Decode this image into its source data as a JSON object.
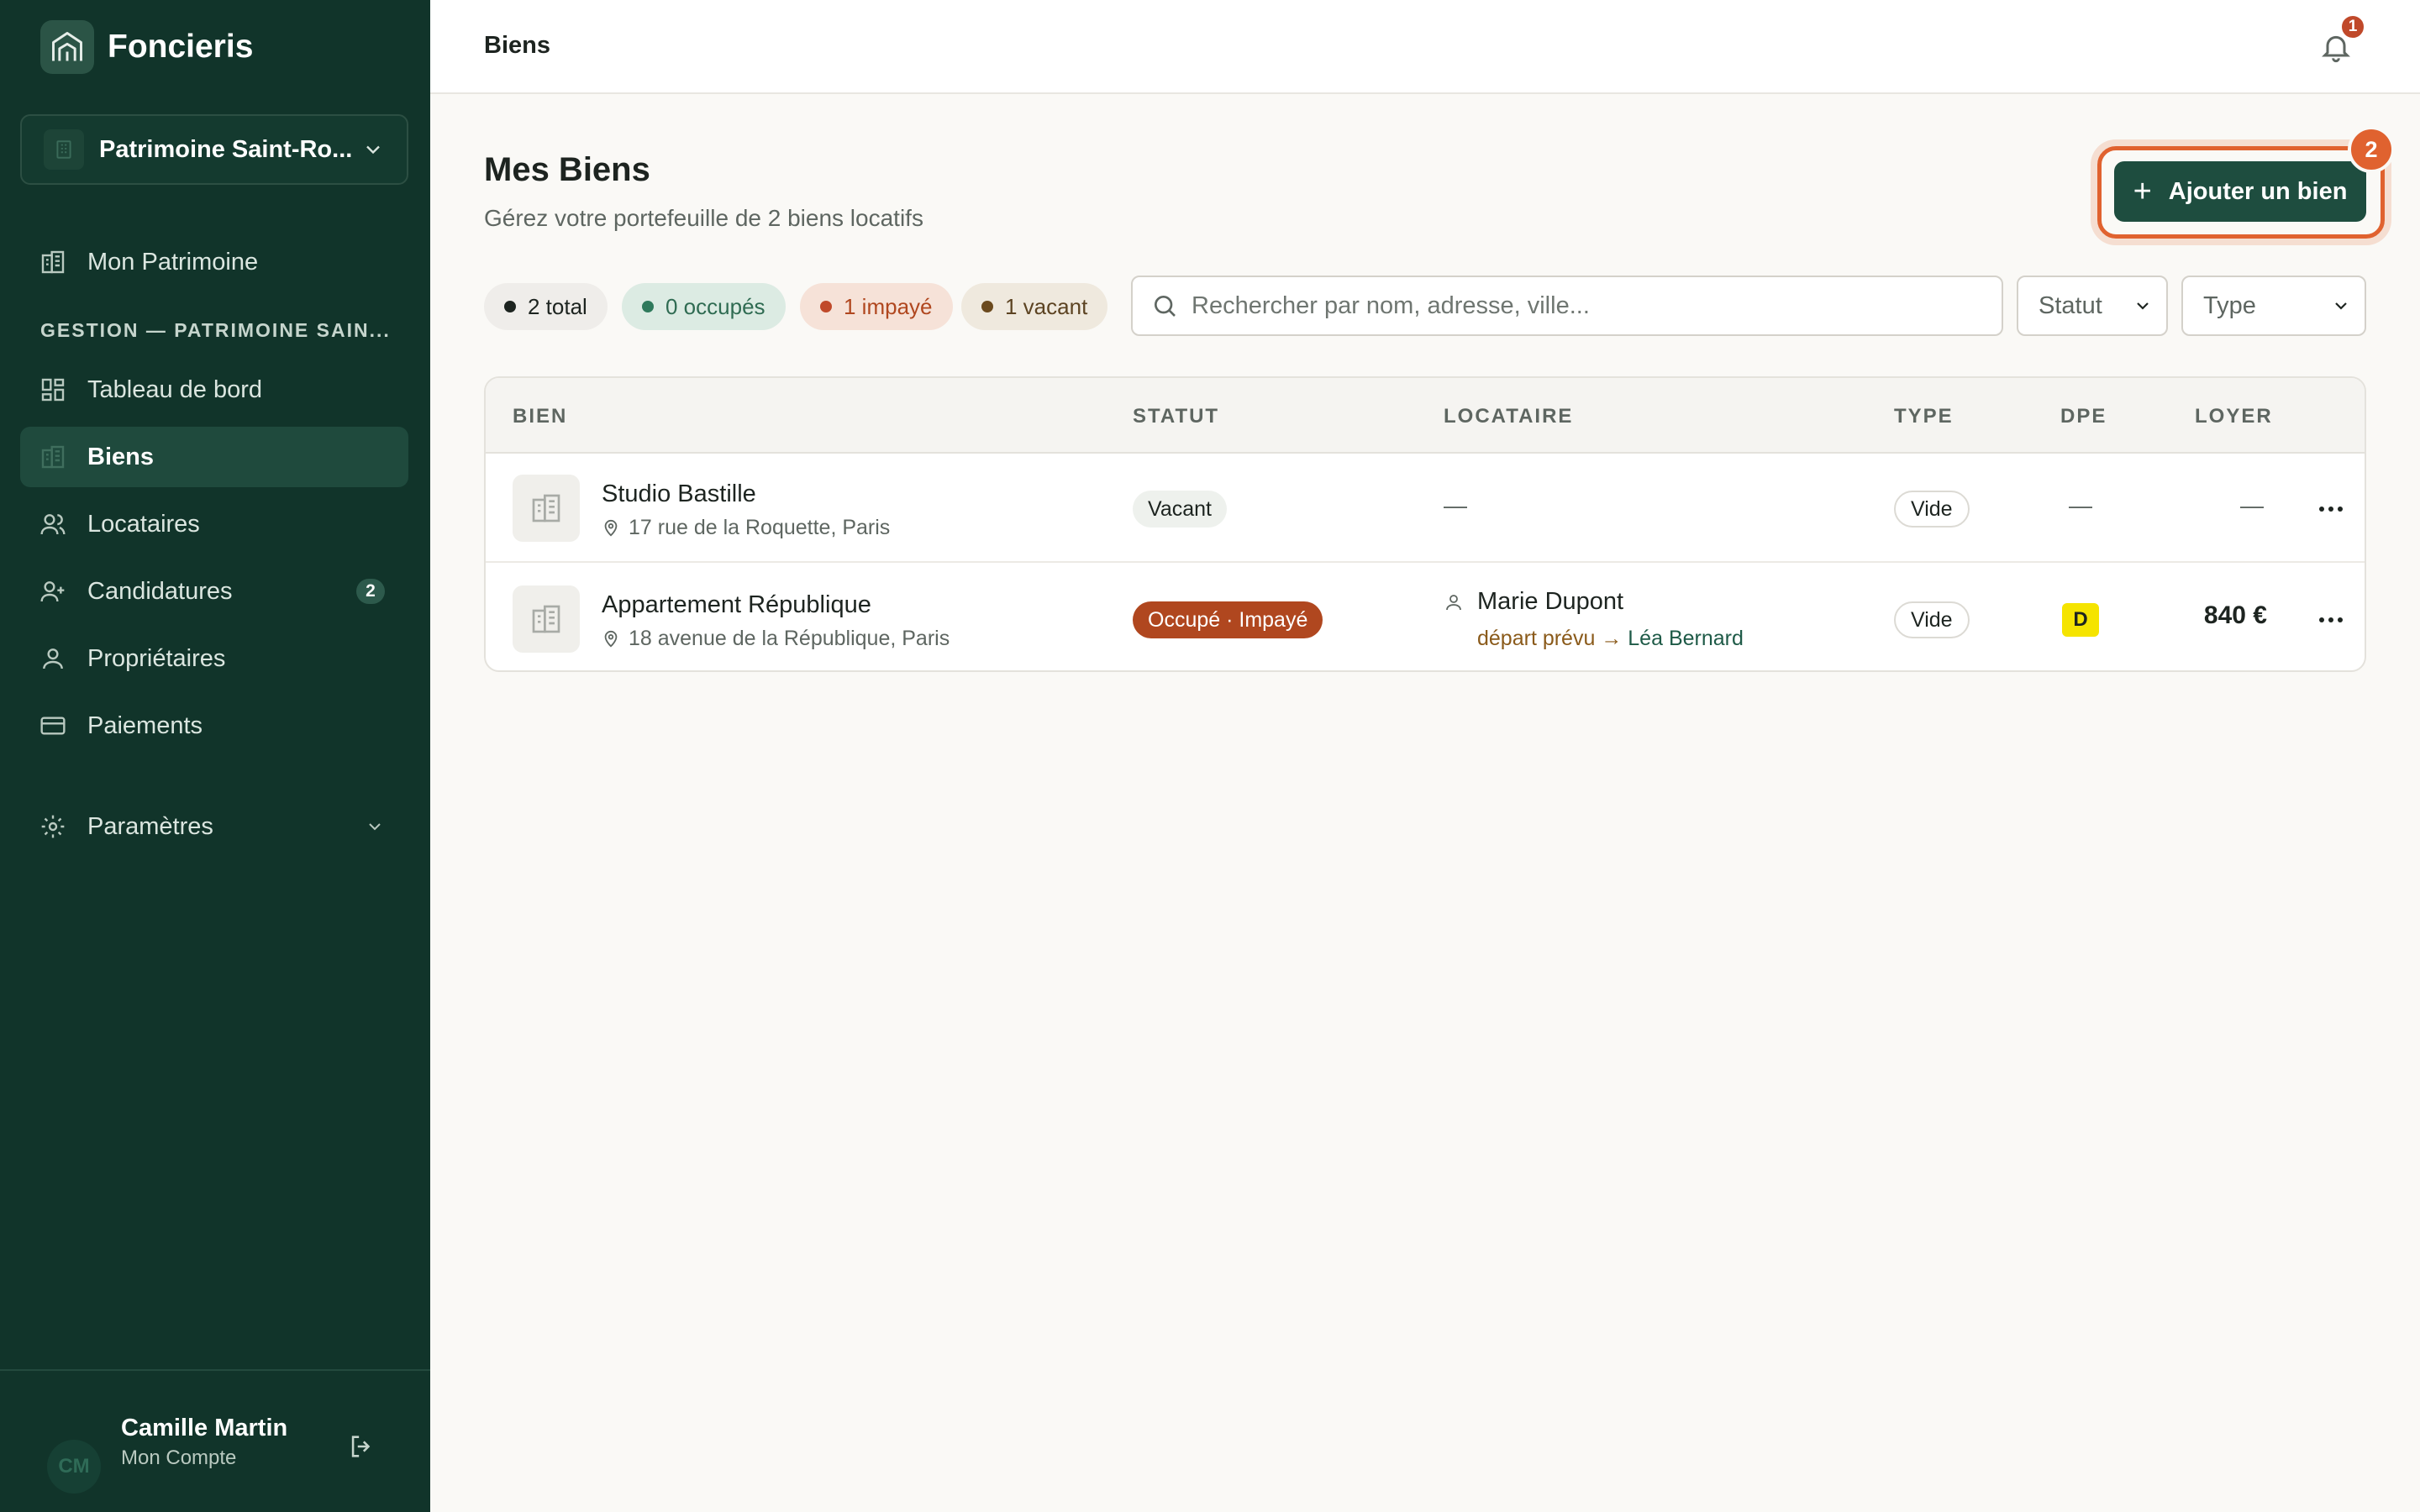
{
  "app": {
    "name": "Foncieris"
  },
  "org_switcher": {
    "label": "Patrimoine Saint-Ro..."
  },
  "nav": {
    "top_item": {
      "label": "Mon Patrimoine"
    },
    "section_label": "GESTION — PATRIMOINE SAIN...",
    "items": [
      {
        "label": "Tableau de bord",
        "icon": "dashboard-icon"
      },
      {
        "label": "Biens",
        "icon": "building-icon",
        "active": true
      },
      {
        "label": "Locataires",
        "icon": "users-icon"
      },
      {
        "label": "Candidatures",
        "icon": "user-plus-icon",
        "count": "2"
      },
      {
        "label": "Propriétaires",
        "icon": "user-icon"
      },
      {
        "label": "Paiements",
        "icon": "card-icon"
      }
    ],
    "settings": {
      "label": "Paramètres",
      "icon": "gear-icon"
    }
  },
  "user": {
    "initials": "CM",
    "name": "Camille Martin",
    "subtitle": "Mon Compte"
  },
  "header": {
    "breadcrumb": "Biens",
    "notifications": "1"
  },
  "main": {
    "title": "Mes Biens",
    "subtitle": "Gérez votre portefeuille de 2 biens locatifs",
    "add_button": "Ajouter un bien",
    "step_badge": "2",
    "chips": [
      {
        "label": "2 total",
        "bg": "#efedea",
        "dot": "#1d2420",
        "color": "#1d2420"
      },
      {
        "label": "0 occupés",
        "bg": "#dcebe3",
        "dot": "#2f7a5c",
        "color": "#2f6b52"
      },
      {
        "label": "1 impayé",
        "bg": "#f6e2d8",
        "dot": "#c0492a",
        "color": "#b0471f"
      },
      {
        "label": "1 vacant",
        "bg": "#efe9de",
        "dot": "#6b4a1e",
        "color": "#5c4322"
      }
    ],
    "search": {
      "placeholder": "Rechercher par nom, adresse, ville..."
    },
    "filters": {
      "status": "Statut",
      "type": "Type"
    }
  },
  "table": {
    "headers": [
      "BIEN",
      "STATUT",
      "LOCATAIRE",
      "TYPE",
      "DPE",
      "LOYER"
    ],
    "rows": [
      {
        "name": "Studio Bastille",
        "address": "17 rue de la Roquette, Paris",
        "status": "Vacant",
        "tenant": "—",
        "type": "Vide",
        "dpe": "—",
        "rent": "—"
      },
      {
        "name": "Appartement République",
        "address": "18 avenue de la République, Paris",
        "status": "Occupé · Impayé",
        "tenant": "Marie Dupont",
        "tenant_note_a": "départ prévu",
        "tenant_note_arrow": "→",
        "tenant_note_b": "Léa Bernard",
        "type": "Vide",
        "dpe": "D",
        "rent": "840 €"
      }
    ]
  },
  "colors": {
    "sidebar": "#11342a",
    "accent": "#1e4d3f",
    "highlight": "#e0622f",
    "unpaid": "#b0471f",
    "dpe_d": "#f5e400"
  }
}
